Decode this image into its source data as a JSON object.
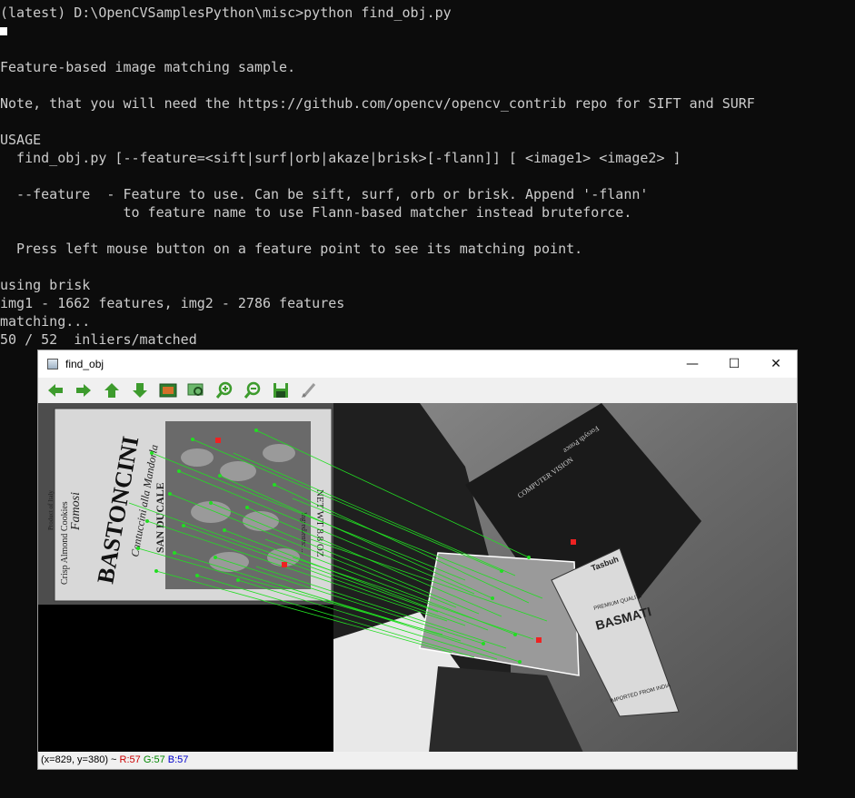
{
  "console": {
    "lines": [
      "(latest) D:\\OpenCVSamplesPython\\misc>python find_obj.py",
      "",
      "Feature-based image matching sample.",
      "",
      "Note, that you will need the https://github.com/opencv/opencv_contrib repo for SIFT and SURF",
      "",
      "USAGE",
      "  find_obj.py [--feature=<sift|surf|orb|akaze|brisk>[-flann]] [ <image1> <image2> ]",
      "",
      "  --feature  - Feature to use. Can be sift, surf, orb or brisk. Append '-flann'",
      "               to feature name to use Flann-based matcher instead bruteforce.",
      "",
      "  Press left mouse button on a feature point to see its matching point.",
      "",
      "using brisk",
      "img1 - 1662 features, img2 - 2786 features",
      "matching...",
      "50 / 52  inliers/matched"
    ]
  },
  "window": {
    "title": "find_obj",
    "minimize": "—",
    "maximize": "☐",
    "close": "✕"
  },
  "toolbar": {
    "buttons": [
      {
        "icon": "arrow-left-icon",
        "glyph": "◀"
      },
      {
        "icon": "arrow-right-icon",
        "glyph": "▶"
      },
      {
        "icon": "arrow-up-icon",
        "glyph": "▲"
      },
      {
        "icon": "arrow-down-icon",
        "glyph": "▼"
      },
      {
        "icon": "fit-image-icon",
        "glyph": "▣"
      },
      {
        "icon": "zoom-rect-icon",
        "glyph": "⬚"
      },
      {
        "icon": "zoom-in-icon",
        "glyph": "+"
      },
      {
        "icon": "zoom-out-icon",
        "glyph": "−"
      },
      {
        "icon": "save-icon",
        "glyph": "H"
      },
      {
        "icon": "properties-icon",
        "glyph": "✎"
      }
    ],
    "accent": "#3d9b2d"
  },
  "image": {
    "box1": {
      "texts": [
        "Crisp Almond Cookies",
        "Product of Italy",
        "Famosi",
        "BASTONCINI",
        "Cantuccini alla Mandorla",
        "SAN DUCALE",
        "NET WT 8.8 OZ",
        "Ingredients: ..."
      ]
    },
    "box2": {
      "texts": [
        "BASMATI",
        "PREMIUM QUALITY",
        "Tasbuh",
        "IMPORTED FROM INDIA",
        "COMPUTER VISION",
        "Forsyth Ponce"
      ]
    },
    "match_color": "#22dd22",
    "outline_color": "#ffffff"
  },
  "status": {
    "coords": "(x=829, y=380) ~ ",
    "r": "R:57",
    "g": "G:57",
    "b": "B:57"
  }
}
